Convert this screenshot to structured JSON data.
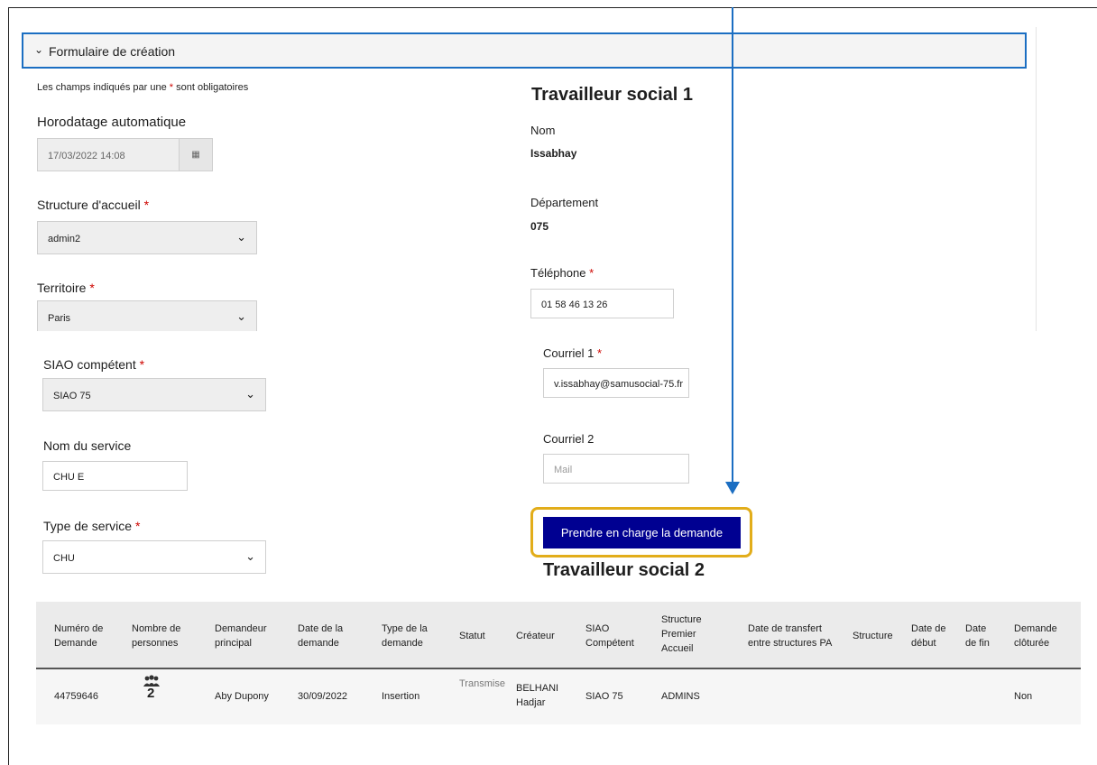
{
  "form": {
    "accordion_label": "Formulaire de création",
    "required_note_before": "Les champs indiqués par une",
    "required_note_after": "sont obligatoires",
    "star": "*",
    "timestamp_label": "Horodatage automatique",
    "timestamp_value": "17/03/2022 14:08",
    "structure_label": "Structure d'accueil",
    "structure_value": "admin2",
    "territoire_label": "Territoire",
    "territoire_value": "Paris",
    "siao_label": "SIAO compétent",
    "siao_value": "SIAO 75",
    "service_label": "Nom du service",
    "service_value": "CHU E",
    "type_service_label": "Type de service",
    "type_service_value": "CHU"
  },
  "social1": {
    "title": "Travailleur social 1",
    "nom_label": "Nom",
    "nom_value": "Issabhay",
    "dept_label": "Département",
    "dept_value": "075",
    "tel_label": "Téléphone",
    "tel_value": "01 58 46 13 26",
    "mail1_label": "Courriel 1",
    "mail1_value": "v.issabhay@samusocial-75.fr",
    "mail2_label": "Courriel 2",
    "mail2_placeholder": "Mail"
  },
  "cta_label": "Prendre en charge la demande",
  "social2_title": "Travailleur social 2",
  "table": {
    "headers": [
      "Numéro de Demande",
      "Nombre de personnes",
      "Demandeur principal",
      "Date de la demande",
      "Type de la demande",
      "Statut",
      "Créateur",
      "SIAO Compétent",
      "Structure Premier Accueil",
      "Date de transfert entre structures PA",
      "Structure",
      "Date de début",
      "Date de fin",
      "Demande clôturée"
    ],
    "row": {
      "numero": "44759646",
      "personnes": "2",
      "demandeur": "Aby Dupony",
      "date": "30/09/2022",
      "type": "Insertion",
      "statut": "Transmise",
      "createur": "BELHANI Hadjar",
      "siao": "SIAO 75",
      "structure_pa": "ADMINS",
      "cloturee": "Non"
    }
  },
  "colors": {
    "primary": "#000091",
    "accent_ring": "#e2ad1a",
    "arrow": "#1b6ec2",
    "required": "#ce0500"
  },
  "icons": [
    "chevron-down-icon",
    "calendar-icon",
    "group-icon"
  ]
}
